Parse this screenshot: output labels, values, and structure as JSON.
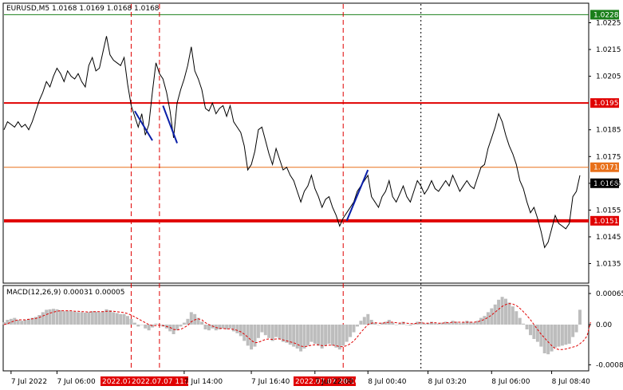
{
  "chart_data": [
    {
      "type": "line",
      "symbol_header": "EURUSD,M5  1.0168 1.0169 1.0168 1.0168",
      "x_ticks": [
        "7 Jul 2022",
        "7 Jul 06:00",
        "7 Jul 14:00",
        "7 Jul 16:40",
        "7 Jul 22:00",
        "8 Jul 00:40",
        "8 Jul 03:20",
        "8 Jul 06:00",
        "8 Jul 08:40"
      ],
      "x_markers": [
        "2022.07",
        "2022.07.07 11:35",
        "2022.07.07 20:10"
      ],
      "y_ticks": [
        "1.0225",
        "1.0215",
        "1.0205",
        "1.0185",
        "1.0175",
        "1.0165",
        "1.0155",
        "1.0145",
        "1.0135"
      ],
      "ylim": [
        1.0128,
        1.0232
      ],
      "levels": [
        {
          "value": 1.0228,
          "label": "1.0228",
          "color": "#1a7f1a"
        },
        {
          "value": 1.0195,
          "label": "1.0195",
          "color": "#e00000"
        },
        {
          "value": 1.0171,
          "label": "1.0171",
          "color": "#e8701a"
        },
        {
          "value": 1.0151,
          "label": "1.0151",
          "color": "#e00000"
        }
      ],
      "current_price": {
        "value": 1.0168,
        "label": "1.0168"
      },
      "price": [
        1.0185,
        1.0188,
        1.0187,
        1.0186,
        1.0188,
        1.0186,
        1.0187,
        1.0185,
        1.0188,
        1.0192,
        1.0196,
        1.0199,
        1.0203,
        1.0201,
        1.0205,
        1.0208,
        1.0206,
        1.0203,
        1.0207,
        1.0205,
        1.0204,
        1.0206,
        1.0203,
        1.0201,
        1.0209,
        1.0212,
        1.0207,
        1.0208,
        1.0214,
        1.022,
        1.0213,
        1.0211,
        1.021,
        1.0209,
        1.0212,
        1.0202,
        1.0194,
        1.019,
        1.0186,
        1.0191,
        1.0183,
        1.0187,
        1.0199,
        1.021,
        1.0206,
        1.0204,
        1.0199,
        1.0192,
        1.0182,
        1.0195,
        1.02,
        1.0204,
        1.0209,
        1.0216,
        1.0207,
        1.0204,
        1.02,
        1.0193,
        1.0192,
        1.0195,
        1.0191,
        1.0193,
        1.0194,
        1.019,
        1.0194,
        1.0188,
        1.0186,
        1.0184,
        1.0179,
        1.017,
        1.0172,
        1.0177,
        1.0185,
        1.0186,
        1.0181,
        1.0176,
        1.0172,
        1.0178,
        1.0174,
        1.017,
        1.0171,
        1.0168,
        1.0166,
        1.0162,
        1.0158,
        1.0162,
        1.0164,
        1.0168,
        1.0163,
        1.016,
        1.0156,
        1.0159,
        1.016,
        1.0156,
        1.0153,
        1.0149,
        1.0152,
        1.0154,
        1.0156,
        1.0158,
        1.0162,
        1.0164,
        1.0166,
        1.0168,
        1.016,
        1.0158,
        1.0156,
        1.016,
        1.0162,
        1.0166,
        1.016,
        1.0158,
        1.0161,
        1.0164,
        1.016,
        1.0158,
        1.0162,
        1.0166,
        1.0164,
        1.0161,
        1.0163,
        1.0166,
        1.0163,
        1.0162,
        1.0164,
        1.0166,
        1.0164,
        1.0168,
        1.0165,
        1.0162,
        1.0164,
        1.0166,
        1.0164,
        1.0163,
        1.0167,
        1.0171,
        1.0172,
        1.0178,
        1.0182,
        1.0186,
        1.0191,
        1.0188,
        1.0183,
        1.0179,
        1.0176,
        1.0172,
        1.0166,
        1.0163,
        1.0158,
        1.0154,
        1.0156,
        1.0152,
        1.0147,
        1.0141,
        1.0143,
        1.0148,
        1.0153,
        1.015,
        1.0149,
        1.0148,
        1.015,
        1.016,
        1.0162,
        1.0168
      ],
      "blue_segments": [
        {
          "from": [
            1.0192,
            1.0181
          ],
          "span": [
            37,
            42
          ]
        },
        {
          "from": [
            1.0194,
            1.018
          ],
          "span": [
            45,
            49
          ]
        },
        {
          "from": [
            1.0151,
            1.017
          ],
          "span": [
            97,
            103
          ]
        }
      ]
    },
    {
      "type": "area",
      "indicator_header": "MACD(12,26,9) 0.00031 0.00005",
      "y_ticks": [
        "0.00065",
        "0.00",
        "-0.00084"
      ],
      "ylim": [
        -0.00095,
        0.0008
      ],
      "histogram": [
        5e-05,
        0.0001,
        0.00012,
        0.00014,
        0.0001,
        8e-05,
        0.0001,
        0.00012,
        0.00014,
        0.00016,
        0.0002,
        0.00026,
        0.00031,
        0.00032,
        0.00033,
        0.00032,
        0.0003,
        0.00028,
        0.00029,
        0.00028,
        0.00027,
        0.00026,
        0.00026,
        0.00025,
        0.00026,
        0.00028,
        0.00027,
        0.00026,
        0.00028,
        0.00032,
        0.0003,
        0.00026,
        0.00024,
        0.00022,
        0.00022,
        0.00018,
        0.00012,
        4e-05,
        -4e-05,
        0.0,
        -8e-05,
        -0.00012,
        -6e-05,
        2e-05,
        0.0,
        -4e-05,
        -8e-05,
        -0.00014,
        -0.0002,
        -0.00012,
        -4e-05,
        4e-05,
        0.00012,
        0.00026,
        0.00022,
        0.00014,
        6e-05,
        -0.0001,
        -0.00012,
        -8e-05,
        -0.00012,
        -0.0001,
        -8e-05,
        -0.0001,
        -8e-05,
        -0.00014,
        -0.00018,
        -0.00024,
        -0.00034,
        -0.00044,
        -0.00052,
        -0.00046,
        -0.00028,
        -0.00016,
        -0.00022,
        -0.00028,
        -0.00034,
        -0.00026,
        -0.0003,
        -0.00036,
        -0.00038,
        -0.00042,
        -0.00046,
        -0.0005,
        -0.00056,
        -0.0005,
        -0.00044,
        -0.00036,
        -0.0004,
        -0.00044,
        -0.0005,
        -0.00044,
        -0.0004,
        -0.00044,
        -0.00048,
        -0.00052,
        -0.00044,
        -0.00036,
        -0.00026,
        -0.00016,
        -4e-05,
        8e-05,
        0.00016,
        0.00022,
        0.0001,
        4e-05,
        0.0,
        4e-05,
        6e-05,
        0.0001,
        4e-05,
        0.0,
        2e-05,
        6e-05,
        0.0,
        -2e-05,
        2e-05,
        6e-05,
        6e-05,
        2e-05,
        3e-05,
        6e-05,
        3e-05,
        2e-05,
        4e-05,
        6e-05,
        4e-05,
        8e-05,
        6e-05,
        3e-05,
        5e-05,
        8e-05,
        6e-05,
        4e-05,
        8e-05,
        0.00014,
        0.00018,
        0.00026,
        0.00034,
        0.00042,
        0.00052,
        0.00058,
        0.00054,
        0.00046,
        0.00038,
        0.00028,
        0.00014,
        2e-05,
        -0.0001,
        -0.00022,
        -0.0003,
        -0.00036,
        -0.00046,
        -0.0006,
        -0.00062,
        -0.00056,
        -0.00048,
        -0.00046,
        -0.00044,
        -0.00042,
        -0.0004,
        -0.00026,
        -0.00016,
        0.00031
      ],
      "signal": [
        0.0,
        2e-05,
        5e-05,
        8e-05,
        0.0001,
        0.0001,
        0.0001,
        0.00011,
        0.00012,
        0.00013,
        0.00015,
        0.00018,
        0.00021,
        0.00024,
        0.00026,
        0.00028,
        0.00029,
        0.00029,
        0.00029,
        0.00029,
        0.00028,
        0.00028,
        0.00027,
        0.00027,
        0.00026,
        0.00027,
        0.00027,
        0.00027,
        0.00027,
        0.00028,
        0.00028,
        0.00028,
        0.00027,
        0.00026,
        0.00025,
        0.00023,
        0.0002,
        0.00016,
        0.00012,
        8e-05,
        4e-05,
        0.0,
        -2e-05,
        -2e-05,
        -1e-05,
        -2e-05,
        -4e-05,
        -6e-05,
        -0.0001,
        -0.00011,
        -0.0001,
        -6e-05,
        -2e-05,
        6e-05,
        0.0001,
        0.00012,
        0.0001,
        4e-05,
        0.0,
        -3e-05,
        -6e-05,
        -8e-05,
        -8e-05,
        -9e-05,
        -9e-05,
        -0.0001,
        -0.00012,
        -0.00015,
        -0.0002,
        -0.00026,
        -0.00033,
        -0.00038,
        -0.00037,
        -0.00034,
        -0.00031,
        -0.0003,
        -0.00031,
        -0.0003,
        -0.0003,
        -0.00032,
        -0.00034,
        -0.00036,
        -0.00038,
        -0.00041,
        -0.00045,
        -0.00046,
        -0.00045,
        -0.00043,
        -0.00042,
        -0.00042,
        -0.00044,
        -0.00044,
        -0.00043,
        -0.00043,
        -0.00044,
        -0.00046,
        -0.00046,
        -0.00044,
        -0.0004,
        -0.00034,
        -0.00026,
        -0.00016,
        -8e-05,
        0.0,
        3e-05,
        4e-05,
        3e-05,
        3e-05,
        4e-05,
        5e-05,
        5e-05,
        4e-05,
        3e-05,
        4e-05,
        3e-05,
        2e-05,
        2e-05,
        3e-05,
        4e-05,
        3e-05,
        3e-05,
        4e-05,
        4e-05,
        3e-05,
        3e-05,
        4e-05,
        4e-05,
        5e-05,
        5e-05,
        5e-05,
        5e-05,
        5e-05,
        5e-05,
        5e-05,
        6e-05,
        8e-05,
        0.00011,
        0.00015,
        0.0002,
        0.00026,
        0.00032,
        0.00038,
        0.00042,
        0.00044,
        0.00043,
        0.0004,
        0.00034,
        0.00027,
        0.00019,
        0.0001,
        0.0,
        -0.0001,
        -0.0002,
        -0.00028,
        -0.00036,
        -0.00044,
        -0.0005,
        -0.00052,
        -0.00052,
        -0.00051,
        -0.00049,
        -0.00047,
        -0.00045,
        -0.0004,
        -0.00034,
        -0.00024,
        5e-05
      ]
    }
  ],
  "colors": {
    "price_line": "#000000",
    "blue_line": "#0a1fa8",
    "histogram": "#bdbdbd",
    "signal_line": "#e00000",
    "marker_line": "#e00000",
    "marker_label_bg": "#e00000",
    "current_price_bg": "#000000"
  }
}
